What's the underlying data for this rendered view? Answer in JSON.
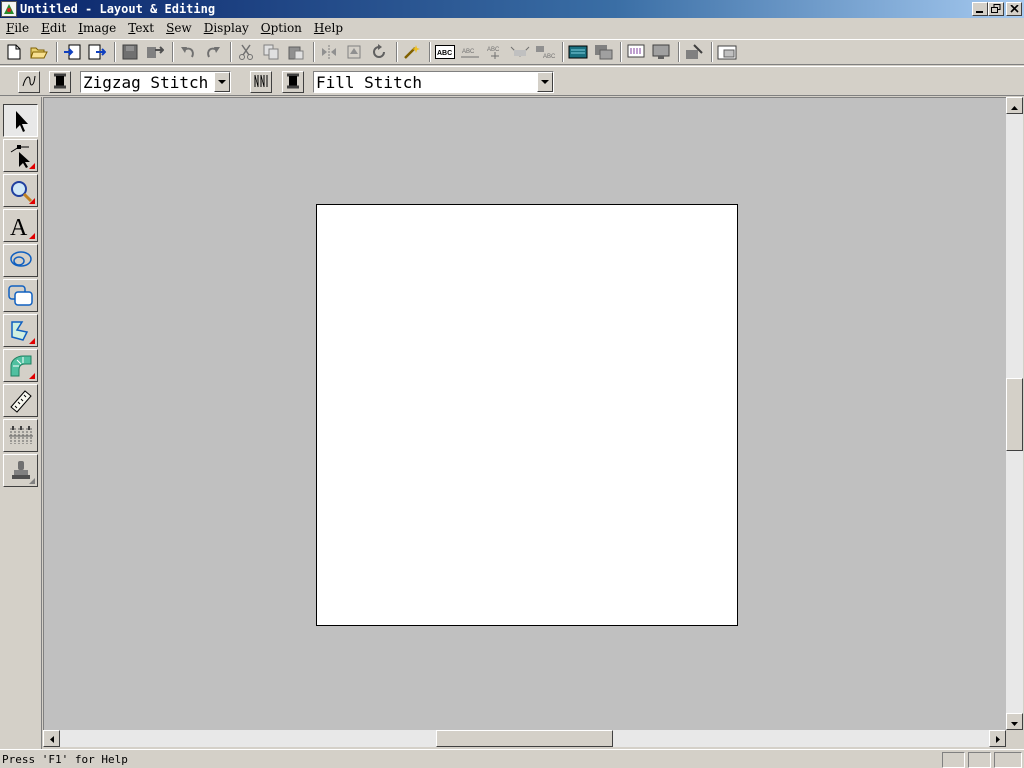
{
  "window": {
    "title": "Untitled - Layout & Editing",
    "controls": {
      "minimize": "minimize-icon",
      "restore": "restore-icon",
      "close": "close-icon"
    }
  },
  "menu": {
    "items": [
      {
        "key": "F",
        "rest": "ile"
      },
      {
        "key": "E",
        "rest": "dit"
      },
      {
        "key": "I",
        "rest": "mage"
      },
      {
        "key": "T",
        "rest": "ext"
      },
      {
        "key": "S",
        "rest": "ew"
      },
      {
        "key": "D",
        "rest": "isplay"
      },
      {
        "key": "O",
        "rest": "ption"
      },
      {
        "key": "H",
        "rest": "elp"
      }
    ]
  },
  "toolbar": {
    "icons": [
      "new-file-icon",
      "open-folder-icon",
      "import-icon",
      "export-icon",
      "save-icon",
      "transfer-icon",
      "undo-icon",
      "redo-icon",
      "cut-icon",
      "copy-icon",
      "paste-icon",
      "mirror-icon",
      "flip-icon",
      "rotate-icon",
      "magic-wand-icon",
      "abc-text-icon",
      "text-on-path-icon",
      "text-arc-icon",
      "text-transform-icon",
      "text-fit-icon",
      "stitch-preview-icon",
      "stitch-simulator-icon",
      "design-property-icon",
      "display-icon",
      "card-write-icon",
      "design-page-icon"
    ]
  },
  "stitch_bar": {
    "line_stitch": "Zigzag Stitch",
    "region_stitch": "Fill Stitch"
  },
  "toolbox": {
    "tools": [
      "select-arrow-icon",
      "point-edit-icon",
      "zoom-icon",
      "text-tool-icon",
      "circle-draw-icon",
      "rectangle-draw-icon",
      "outline-draw-icon",
      "sewing-attribute-icon",
      "measure-icon",
      "stitch-pattern-icon",
      "stamp-icon"
    ]
  },
  "status": {
    "message": "Press 'F1' for Help"
  },
  "colors": {
    "titlebar_start": "#0a246a",
    "titlebar_end": "#a6caf0",
    "workspace": "#c0c0c0",
    "page": "#ffffff",
    "chrome": "#d4d0c8"
  }
}
